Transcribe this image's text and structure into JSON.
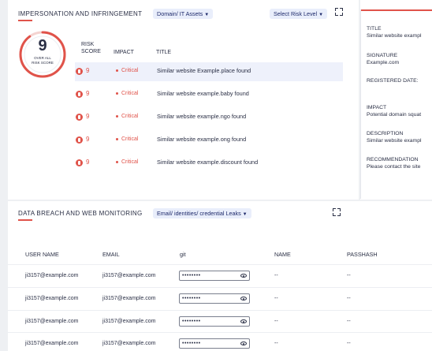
{
  "impersonation": {
    "title": "IMPERSONATION AND INFRINGEMENT",
    "filter": "Domain/ IT Assets",
    "risk_select": "Select Risk Level",
    "score": {
      "value": "9",
      "caption_line1": "OVER ALL",
      "caption_line2": "RISK SCORE",
      "fill_fraction": 0.9
    },
    "headers": {
      "risk_score_line1": "RISK",
      "risk_score_line2": "SCORE",
      "impact": "IMPACT",
      "title": "TITLE"
    },
    "rows": [
      {
        "score": "9",
        "impact": "Critical",
        "title": "Similar website Example.place found"
      },
      {
        "score": "9",
        "impact": "Critical",
        "title": "Similar website example.baby found"
      },
      {
        "score": "9",
        "impact": "Critical",
        "title": "Similar website example.ngo found"
      },
      {
        "score": "9",
        "impact": "Critical",
        "title": "Similar website example.ong found"
      },
      {
        "score": "9",
        "impact": "Critical",
        "title": "Similar website example.discount found"
      }
    ]
  },
  "detail": {
    "title_label": "TITLE",
    "title_value": "Similar website exampl",
    "signature_label": "SIGNATURE",
    "signature_value": "Example.com",
    "registered_label": "REGISTERED DATE:",
    "impact_label": "IMPACT",
    "impact_value": "Potential domain squat",
    "description_label": "DESCRIPTION",
    "description_value": "Similar website exampl",
    "recommendation_label": "RECOMMENDATION",
    "recommendation_value": "Please contact the site"
  },
  "breach": {
    "title": "DATA BREACH AND WEB MONITORING",
    "filter": "Email/ identities/ credential Leaks",
    "headers": {
      "user": "USER NAME",
      "email": "EMAIL",
      "git": "git",
      "name": "NAME",
      "passhash": "PASSHASH"
    },
    "rows": [
      {
        "user": "ji3157@example.com",
        "email": "ji3157@example.com",
        "password": "••••••••",
        "name": "--",
        "passhash": "--"
      },
      {
        "user": "ji3157@example.com",
        "email": "ji3157@example.com",
        "password": "••••••••",
        "name": "--",
        "passhash": "--"
      },
      {
        "user": "ji3157@example.com",
        "email": "ji3157@example.com",
        "password": "••••••••",
        "name": "--",
        "passhash": "--"
      },
      {
        "user": "ji3157@example.com",
        "email": "ji3157@example.com",
        "password": "••••••••",
        "name": "--",
        "passhash": "--"
      }
    ]
  },
  "colors": {
    "accent": "#e0534a",
    "navy": "#1e2a6b",
    "pill_bg": "#e9eefb",
    "selected_row": "#eef1fb"
  }
}
